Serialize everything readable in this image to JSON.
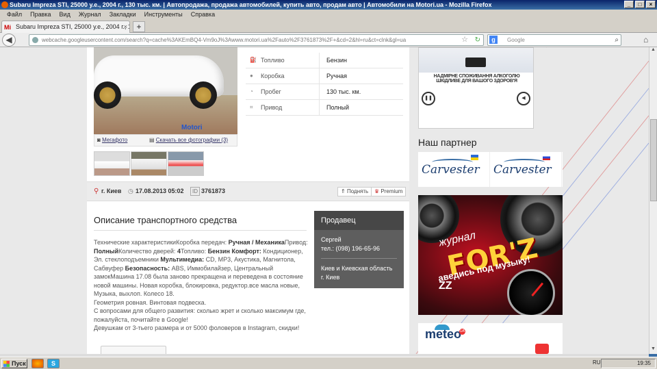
{
  "window": {
    "title": "Subaru Impreza STI, 25000 у.е., 2004 г., 130 тыс. км. | Автопродажа, продажа автомобилей, купить авто, продам авто | Автомобили на Motori.ua - Mozilla Firefox"
  },
  "menu": [
    "Файл",
    "Правка",
    "Вид",
    "Журнал",
    "Закладки",
    "Инструменты",
    "Справка"
  ],
  "tab": {
    "label": "Subaru Impreza STI, 25000 у.е., 2004 г., 1...",
    "favicon": "Mi"
  },
  "url": "webcache.googleusercontent.com/search?q=cache%3AKEmBQ4-Vm9oJ%3Awww.motori.ua%2Fauto%2F3761873%2F+&cd=2&hl=ru&ct=clnk&gl=ua",
  "search": {
    "placeholder": "Google"
  },
  "photo": {
    "watermark": "Motori",
    "megaphoto": "Мегафото",
    "download_all": "Скачать все фотографии (3)"
  },
  "specs": [
    {
      "icon": "fuel-icon",
      "label": "Топливо",
      "value": "Бензин"
    },
    {
      "icon": "gearbox-icon",
      "label": "Коробка",
      "value": "Ручная"
    },
    {
      "icon": "odometer-icon",
      "label": "Пробег",
      "value": "130 тыс. км."
    },
    {
      "icon": "drive-icon",
      "label": "Привод",
      "value": "Полный"
    }
  ],
  "meta": {
    "city": "г. Киев",
    "date": "17.08.2013 05:02",
    "id_label": "ID",
    "id": "3761873",
    "raise": "Поднять",
    "premium": "Premium"
  },
  "description": {
    "title": "Описание транспортного средства",
    "p1": "Технические характеристикиКоробка передач: ",
    "b1": "Ручная / Механика",
    "p2": "Привод: ",
    "b2": "Полный",
    "p3": "Количество дверей: ",
    "b3": "4",
    "p4": "Топливо: ",
    "b4": "Бензин Комфорт:",
    "p5": " Кондиционер, Эл. стеклоподъемники ",
    "b5": "Мультимедиа:",
    "p6": " CD, MP3, Акустика, Магнитола, Сабвуфер ",
    "b6": "Безопасность:",
    "p7": " ABS, Иммобилайзер, Центральный замокМашина 17.08 была заново прекращена и переведена в состояние новой машины. Новая коробка, блокировка, редуктор.все масла новые, Музыка, выхлоп. Колесо 18.",
    "p8": "Геометрия ровная. Винтовая подвеска.",
    "p9": "С вопросами для общего развития: сколько жрет и сколько максимум где, пожалуйста, почитайте в Google!",
    "p10": "Девушкам от 3-тьего размера и от 5000 фоловеров в Instagram, скидки!"
  },
  "seller": {
    "heading": "Продавец",
    "name": "Сергей",
    "phone": "тел.: (098) 196-65-96",
    "region": "Киев и Киевская область",
    "city": "г. Киев"
  },
  "ad_video": {
    "caption": "НАДМІРНЕ СПОЖИВАННЯ АЛКОГОЛЮ ШКІДЛИВЕ ДЛЯ ВАШОГО ЗДОРОВ'Я"
  },
  "partner": {
    "title": "Наш партнер",
    "logos": [
      {
        "name": "Carvester",
        "flag": "ua"
      },
      {
        "name": "Carvester",
        "flag": "ru"
      }
    ]
  },
  "forz": {
    "journal": "журнал",
    "logo": "FOR'Z",
    "slogan": "аведись под музыку!",
    "zz": "ZZ"
  },
  "meteo": {
    "logo": "meteo",
    "badge": "UA"
  },
  "taskbar": {
    "start": "Пуск",
    "lang": "RU",
    "time": "19:35"
  },
  "colors": {
    "seller_bg": "#5e5e5e",
    "forz_red": "#c01020",
    "meteo_blue": "#1b3d6f"
  }
}
